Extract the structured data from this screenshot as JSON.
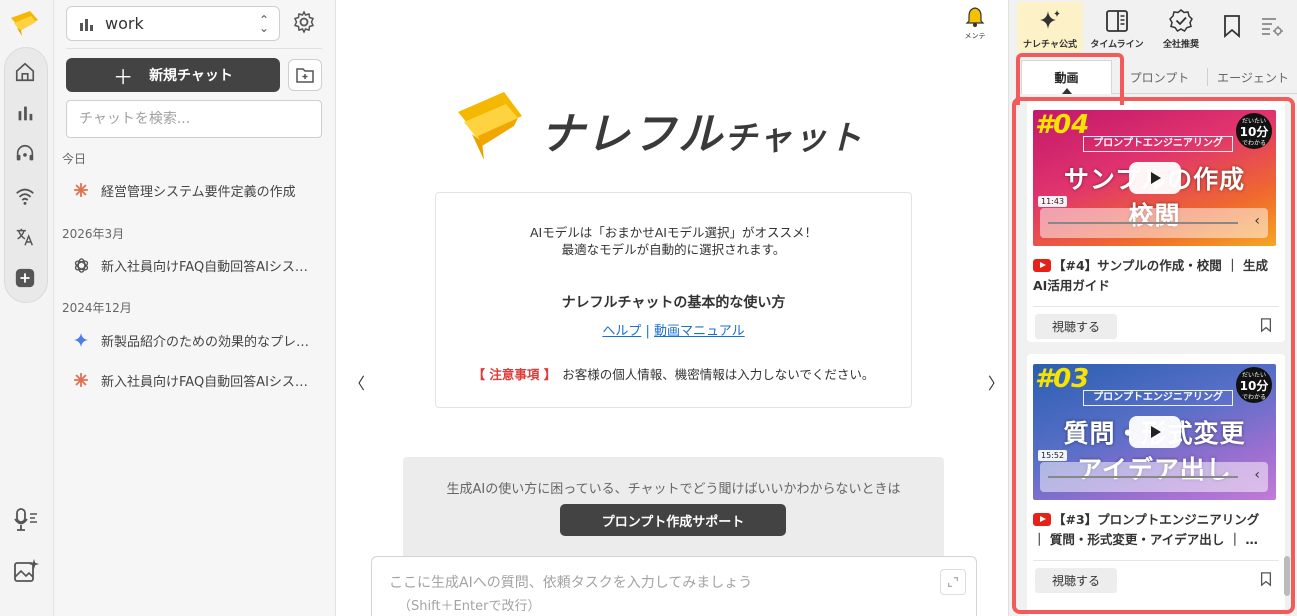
{
  "rail": {
    "logo": "narefuru-logo",
    "icons": [
      "home-icon",
      "chart-icon",
      "support-icon",
      "wifi-icon",
      "translate-icon",
      "plus-icon"
    ],
    "bottom_icons": [
      "voice-icon",
      "image-ai-icon"
    ]
  },
  "sidebar": {
    "workspace": "work",
    "new_chat": "新規チャット",
    "search_placeholder": "チャットを検索...",
    "sections": [
      {
        "label": "今日",
        "items": [
          {
            "title": "経営管理システム要件定義の作成",
            "icon": "claude-icon"
          }
        ]
      },
      {
        "label": "2026年3月",
        "items": [
          {
            "title": "新入社員向けFAQ自動回答AIシス…",
            "icon": "openai-icon"
          }
        ]
      },
      {
        "label": "2024年12月",
        "items": [
          {
            "title": "新製品紹介のための効果的なプレ…",
            "icon": "gemini-icon"
          },
          {
            "title": "新入社員向けFAQ自動回答AIシス…",
            "icon": "claude-icon"
          }
        ]
      }
    ]
  },
  "main": {
    "bell_label": "メンテ",
    "brand": {
      "big": "ナレフル",
      "small": "チャット"
    },
    "info": {
      "line1": "AIモデルは「おまかせAIモデル選択」がオススメ！",
      "line2": "最適なモデルが自動的に選択されます。",
      "howto": "ナレフルチャットの基本的な使い方",
      "link_help": "ヘルプ",
      "link_sep": "|",
      "link_manual": "動画マニュアル",
      "caution_label": "【 注意事項 】",
      "caution_text": "お客様の個人情報、機密情報は入力しないでください。"
    },
    "nav_prev": "〈",
    "nav_next": "〉",
    "help": {
      "question": "生成AIの使い方に困っている、チャットでどう聞けばいいかわからないときは",
      "button": "プロンプト作成サポート"
    },
    "input": {
      "placeholder1": "ここに生成AIへの質問、依頼タスクを入力してみましょう",
      "placeholder2": "（Shift＋Enterで改行）"
    }
  },
  "rpanel": {
    "top_buttons": [
      {
        "label": "ナレチャ公式",
        "icon": "sparkle-icon",
        "active": true
      },
      {
        "label": "タイムライン",
        "icon": "timeline-icon",
        "active": false
      },
      {
        "label": "全社推奨",
        "icon": "badge-check-icon",
        "active": false
      }
    ],
    "tabs": [
      "動画",
      "プロンプト",
      "エージェント"
    ],
    "videos": [
      {
        "num": "#04",
        "ribbon": "プロンプトエンジニアリング",
        "big1": "サンプルの作成",
        "big2": "校閲",
        "badge_top": "だいたい",
        "badge_main": "10分",
        "badge_bottom": "でわかる",
        "duration": "11:43",
        "title": "【#4】サンプルの作成・校閲 ｜ 生成AI活用ガイド",
        "watch": "視聴する"
      },
      {
        "num": "#03",
        "ribbon": "プロンプトエンジニアリング",
        "big1": "質問・形式変更",
        "big2": "アイデア出し",
        "badge_top": "だいたい",
        "badge_main": "10分",
        "badge_bottom": "でわかる",
        "duration": "15:52",
        "title": "【#3】プロンプトエンジニアリング ｜ 質問・形式変更・アイデア出し ｜ …",
        "watch": "視聴する"
      }
    ],
    "highlight_color": "#f35b5b"
  }
}
